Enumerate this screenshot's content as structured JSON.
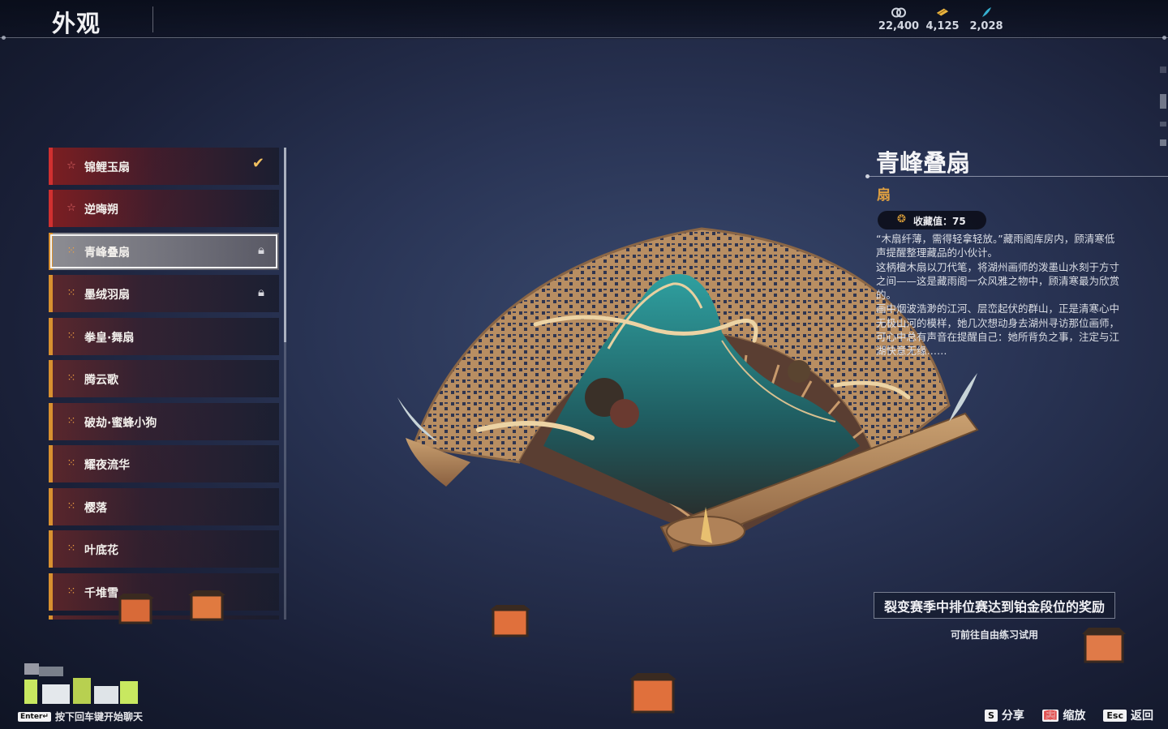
{
  "header": {
    "title": "外观",
    "currencies": [
      {
        "icon": "coin-icon",
        "value": "22,400"
      },
      {
        "icon": "ticket-icon",
        "value": "4,125"
      },
      {
        "icon": "feather-icon",
        "value": "2,028"
      }
    ]
  },
  "list": {
    "items": [
      {
        "label": "锦鲤玉扇",
        "icon": "star-icon",
        "rarity": "red",
        "status": "owned"
      },
      {
        "label": "逆晦朔",
        "icon": "star-icon",
        "rarity": "red",
        "status": ""
      },
      {
        "label": "青峰叠扇",
        "icon": "rarity-icon",
        "rarity": "gold",
        "status": "locked",
        "selected": true
      },
      {
        "label": "墨绒羽扇",
        "icon": "rarity-icon",
        "rarity": "gold",
        "status": "locked"
      },
      {
        "label": "拳皇·舞扇",
        "icon": "rarity-icon",
        "rarity": "gold",
        "status": ""
      },
      {
        "label": "腾云歌",
        "icon": "rarity-icon",
        "rarity": "gold",
        "status": ""
      },
      {
        "label": "破劫·蜜蜂小狗",
        "icon": "rarity-icon",
        "rarity": "gold",
        "status": ""
      },
      {
        "label": "耀夜流华",
        "icon": "rarity-icon",
        "rarity": "gold",
        "status": ""
      },
      {
        "label": "樱落",
        "icon": "rarity-icon",
        "rarity": "gold",
        "status": ""
      },
      {
        "label": "叶底花",
        "icon": "rarity-icon",
        "rarity": "gold",
        "status": ""
      },
      {
        "label": "千堆雪",
        "icon": "rarity-icon",
        "rarity": "gold",
        "status": ""
      }
    ]
  },
  "detail": {
    "name": "青峰叠扇",
    "type": "扇",
    "collect_label": "收藏值：75",
    "description": [
      "“木扇纤薄，需得轻拿轻放。”藏雨阁库房内，顾清寒低声提醒整理藏品的小伙计。",
      "这柄檀木扇以刀代笔，将湖州画师的泼墨山水刻于方寸之间——这是藏雨阁一众风雅之物中，顾清寒最为欣赏的。",
      "画中烟波浩渺的江河、层峦起伏的群山，正是清寒心中无极山河的模样，她几次想动身去湖州寻访那位画师，可心中总有声音在提醒自己：她所背负之事，注定与江湖快意无缘……"
    ],
    "reward_text": "裂变赛季中排位赛达到铂金段位的奖励",
    "trial_text": "可前往自由练习试用"
  },
  "footer": {
    "enter_key": "Enter↵",
    "enter_hint": "按下回车键开始聊天",
    "actions": [
      {
        "key": "S",
        "label": "分享"
      },
      {
        "key": "📖",
        "label": "缩放"
      },
      {
        "key": "Esc",
        "label": "返回"
      }
    ]
  },
  "colors": {
    "accent_gold": "#e0a040",
    "rarity_red": "#d03030",
    "rarity_gold": "#d89030"
  }
}
